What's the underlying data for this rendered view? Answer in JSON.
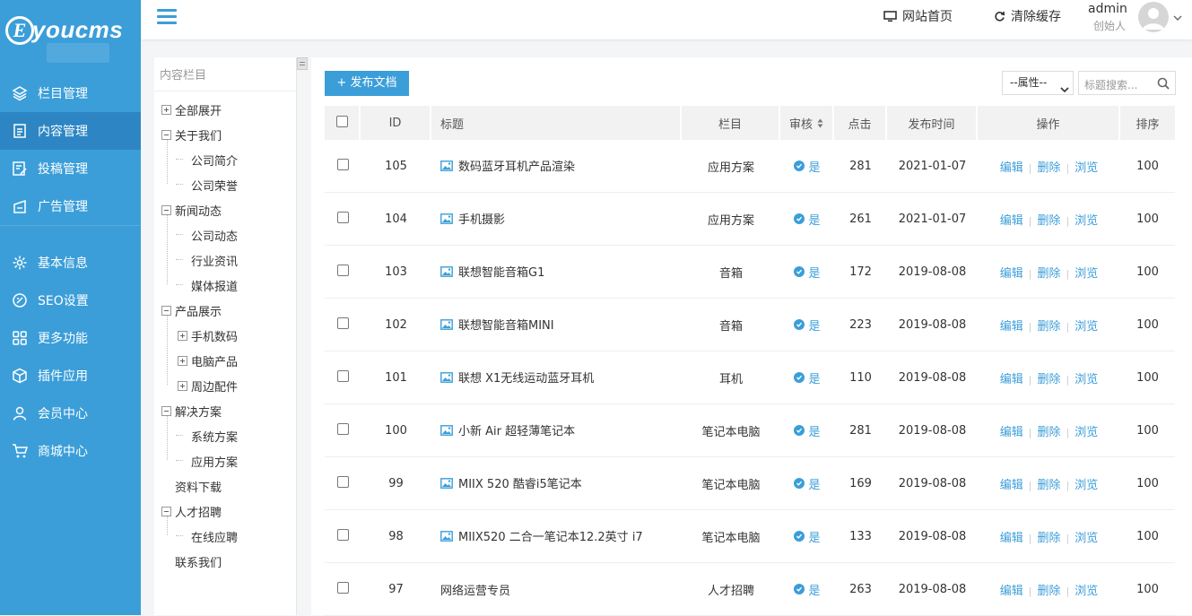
{
  "brand": {
    "logo_letter": "E",
    "name": "youcms"
  },
  "sidebar": {
    "items": [
      {
        "label": "栏目管理",
        "icon": "layers-icon"
      },
      {
        "label": "内容管理",
        "icon": "document-icon",
        "active": true
      },
      {
        "label": "投稿管理",
        "icon": "submit-icon"
      },
      {
        "label": "广告管理",
        "icon": "ad-icon"
      },
      {
        "label": "基本信息",
        "icon": "gear-icon"
      },
      {
        "label": "SEO设置",
        "icon": "seo-icon"
      },
      {
        "label": "更多功能",
        "icon": "grid-icon"
      },
      {
        "label": "插件应用",
        "icon": "cube-icon"
      },
      {
        "label": "会员中心",
        "icon": "user-icon"
      },
      {
        "label": "商城中心",
        "icon": "cart-icon"
      }
    ]
  },
  "header": {
    "home_link": "网站首页",
    "clear_cache": "清除缓存",
    "user_name": "admin",
    "user_role": "创始人"
  },
  "tree": {
    "title": "内容栏目",
    "nodes": [
      {
        "label": "全部展开",
        "level": 0,
        "toggle": "plus"
      },
      {
        "label": "关于我们",
        "level": 0,
        "toggle": "minus"
      },
      {
        "label": "公司简介",
        "level": 1
      },
      {
        "label": "公司荣誉",
        "level": 1
      },
      {
        "label": "新闻动态",
        "level": 0,
        "toggle": "minus"
      },
      {
        "label": "公司动态",
        "level": 1
      },
      {
        "label": "行业资讯",
        "level": 1
      },
      {
        "label": "媒体报道",
        "level": 1
      },
      {
        "label": "产品展示",
        "level": 0,
        "toggle": "minus"
      },
      {
        "label": "手机数码",
        "level": 1,
        "toggle": "plus"
      },
      {
        "label": "电脑产品",
        "level": 1,
        "toggle": "plus"
      },
      {
        "label": "周边配件",
        "level": 1,
        "toggle": "plus"
      },
      {
        "label": "解决方案",
        "level": 0,
        "toggle": "minus"
      },
      {
        "label": "系统方案",
        "level": 1
      },
      {
        "label": "应用方案",
        "level": 1
      },
      {
        "label": "资料下载",
        "level": 0
      },
      {
        "label": "人才招聘",
        "level": 0,
        "toggle": "minus"
      },
      {
        "label": "在线应聘",
        "level": 1
      },
      {
        "label": "联系我们",
        "level": 0
      }
    ]
  },
  "toolbar": {
    "publish_label": "+ 发布文档",
    "attr_select": "--属性--",
    "search_placeholder": "标题搜索..."
  },
  "table": {
    "columns": [
      "ID",
      "标题",
      "栏目",
      "审核",
      "点击",
      "发布时间",
      "操作",
      "排序"
    ],
    "rows": [
      {
        "id": "105",
        "title": "数码蓝牙耳机产品渲染",
        "has_image": true,
        "category": "应用方案",
        "audit": "是",
        "clicks": "281",
        "date": "2021-01-07",
        "sort": "100"
      },
      {
        "id": "104",
        "title": "手机摄影",
        "has_image": true,
        "category": "应用方案",
        "audit": "是",
        "clicks": "261",
        "date": "2021-01-07",
        "sort": "100"
      },
      {
        "id": "103",
        "title": "联想智能音箱G1",
        "has_image": true,
        "category": "音箱",
        "audit": "是",
        "clicks": "172",
        "date": "2019-08-08",
        "sort": "100"
      },
      {
        "id": "102",
        "title": "联想智能音箱MINI",
        "has_image": true,
        "category": "音箱",
        "audit": "是",
        "clicks": "223",
        "date": "2019-08-08",
        "sort": "100"
      },
      {
        "id": "101",
        "title": "联想 X1无线运动蓝牙耳机",
        "has_image": true,
        "category": "耳机",
        "audit": "是",
        "clicks": "110",
        "date": "2019-08-08",
        "sort": "100"
      },
      {
        "id": "100",
        "title": "小新 Air 超轻薄笔记本",
        "has_image": true,
        "category": "笔记本电脑",
        "audit": "是",
        "clicks": "281",
        "date": "2019-08-08",
        "sort": "100"
      },
      {
        "id": "99",
        "title": "MIIX 520 酷睿i5笔记本",
        "has_image": true,
        "category": "笔记本电脑",
        "audit": "是",
        "clicks": "169",
        "date": "2019-08-08",
        "sort": "100"
      },
      {
        "id": "98",
        "title": "MIIX520 二合一笔记本12.2英寸 i7",
        "has_image": true,
        "category": "笔记本电脑",
        "audit": "是",
        "clicks": "133",
        "date": "2019-08-08",
        "sort": "100"
      },
      {
        "id": "97",
        "title": "网络运营专员",
        "has_image": false,
        "category": "人才招聘",
        "audit": "是",
        "clicks": "263",
        "date": "2019-08-08",
        "sort": "100"
      }
    ],
    "ops": {
      "edit": "编辑",
      "delete": "删除",
      "view": "浏览"
    }
  },
  "colors": {
    "primary": "#3b9ed9",
    "sidebar_active": "#2d86c3"
  }
}
